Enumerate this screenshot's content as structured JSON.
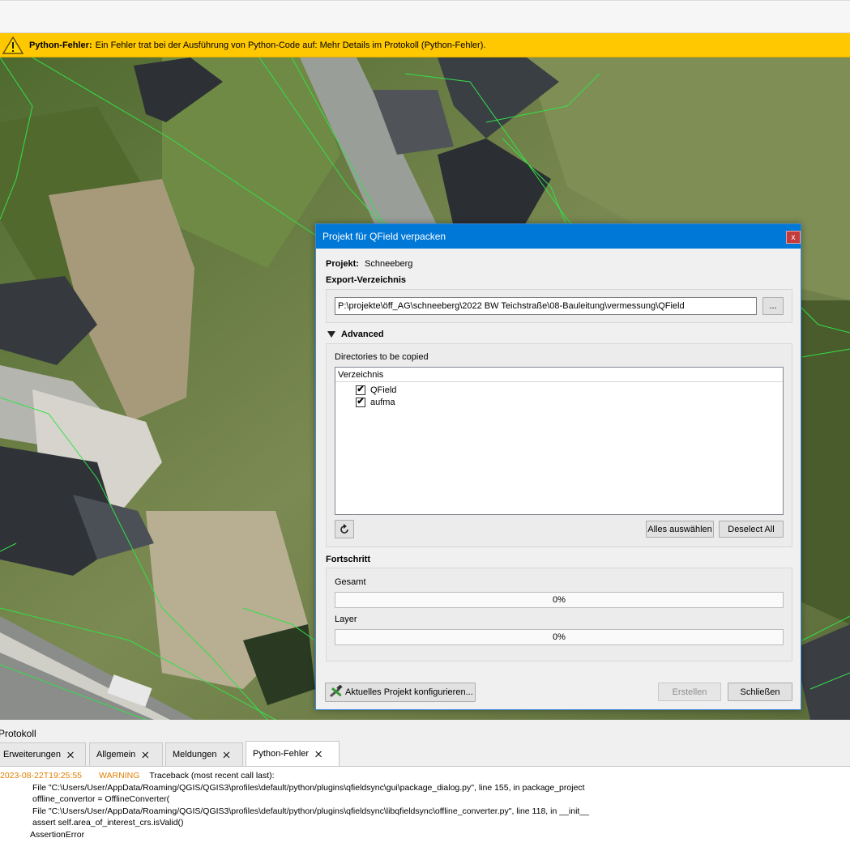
{
  "message_bar": {
    "title": "Python-Fehler:",
    "text": "Ein Fehler trat bei der Ausführung von Python-Code auf: Mehr Details im Protokoll (Python-Fehler).",
    "icon": "warning-icon",
    "color": "#ffc800"
  },
  "dialog": {
    "title": "Projekt für QField verpacken",
    "close_label": "x",
    "project_label": "Projekt:",
    "project_value": "Schneeberg",
    "export_label": "Export-Verzeichnis",
    "export_path": "P:\\projekte\\öff_AG\\schneeberg\\2022 BW Teichstraße\\08-Bauleitung\\vermessung\\QField",
    "browse_label": "...",
    "advanced_label": "Advanced",
    "dirs_label": "Directories to be copied",
    "dirs_header": "Verzeichnis",
    "dirs": [
      {
        "label": "QField",
        "checked": true
      },
      {
        "label": "aufma",
        "checked": true
      }
    ],
    "select_all_label": "Alles auswählen",
    "deselect_all_label": "Deselect All",
    "progress_label": "Fortschritt",
    "total_label": "Gesamt",
    "total_value": "0%",
    "layer_label": "Layer",
    "layer_value": "0%",
    "configure_label": "Aktuelles Projekt konfigurieren...",
    "create_label": "Erstellen",
    "close_button_label": "Schließen",
    "accent": "#0078d7"
  },
  "log_panel": {
    "title": "Protokoll",
    "tabs": [
      {
        "label": "Erweiterungen"
      },
      {
        "label": "Allgemein"
      },
      {
        "label": "Meldungen"
      },
      {
        "label": "Python-Fehler"
      }
    ],
    "tab_close": "🞨",
    "entry": {
      "timestamp": "2023-08-22T19:25:55",
      "level": "WARNING",
      "lines": [
        "Traceback (most recent call last):",
        "File \"C:\\Users/User/AppData/Roaming/QGIS/QGIS3\\profiles\\default/python/plugins\\qfieldsync\\gui\\package_dialog.py\", line 155, in package_project",
        "offline_convertor = OfflineConverter(",
        "File \"C:\\Users/User/AppData/Roaming/QGIS/QGIS3\\profiles\\default/python/plugins\\qfieldsync\\libqfieldsync\\offline_converter.py\", line 118, in __init__",
        "assert self.area_of_interest_crs.isValid()",
        "AssertionError"
      ]
    }
  }
}
